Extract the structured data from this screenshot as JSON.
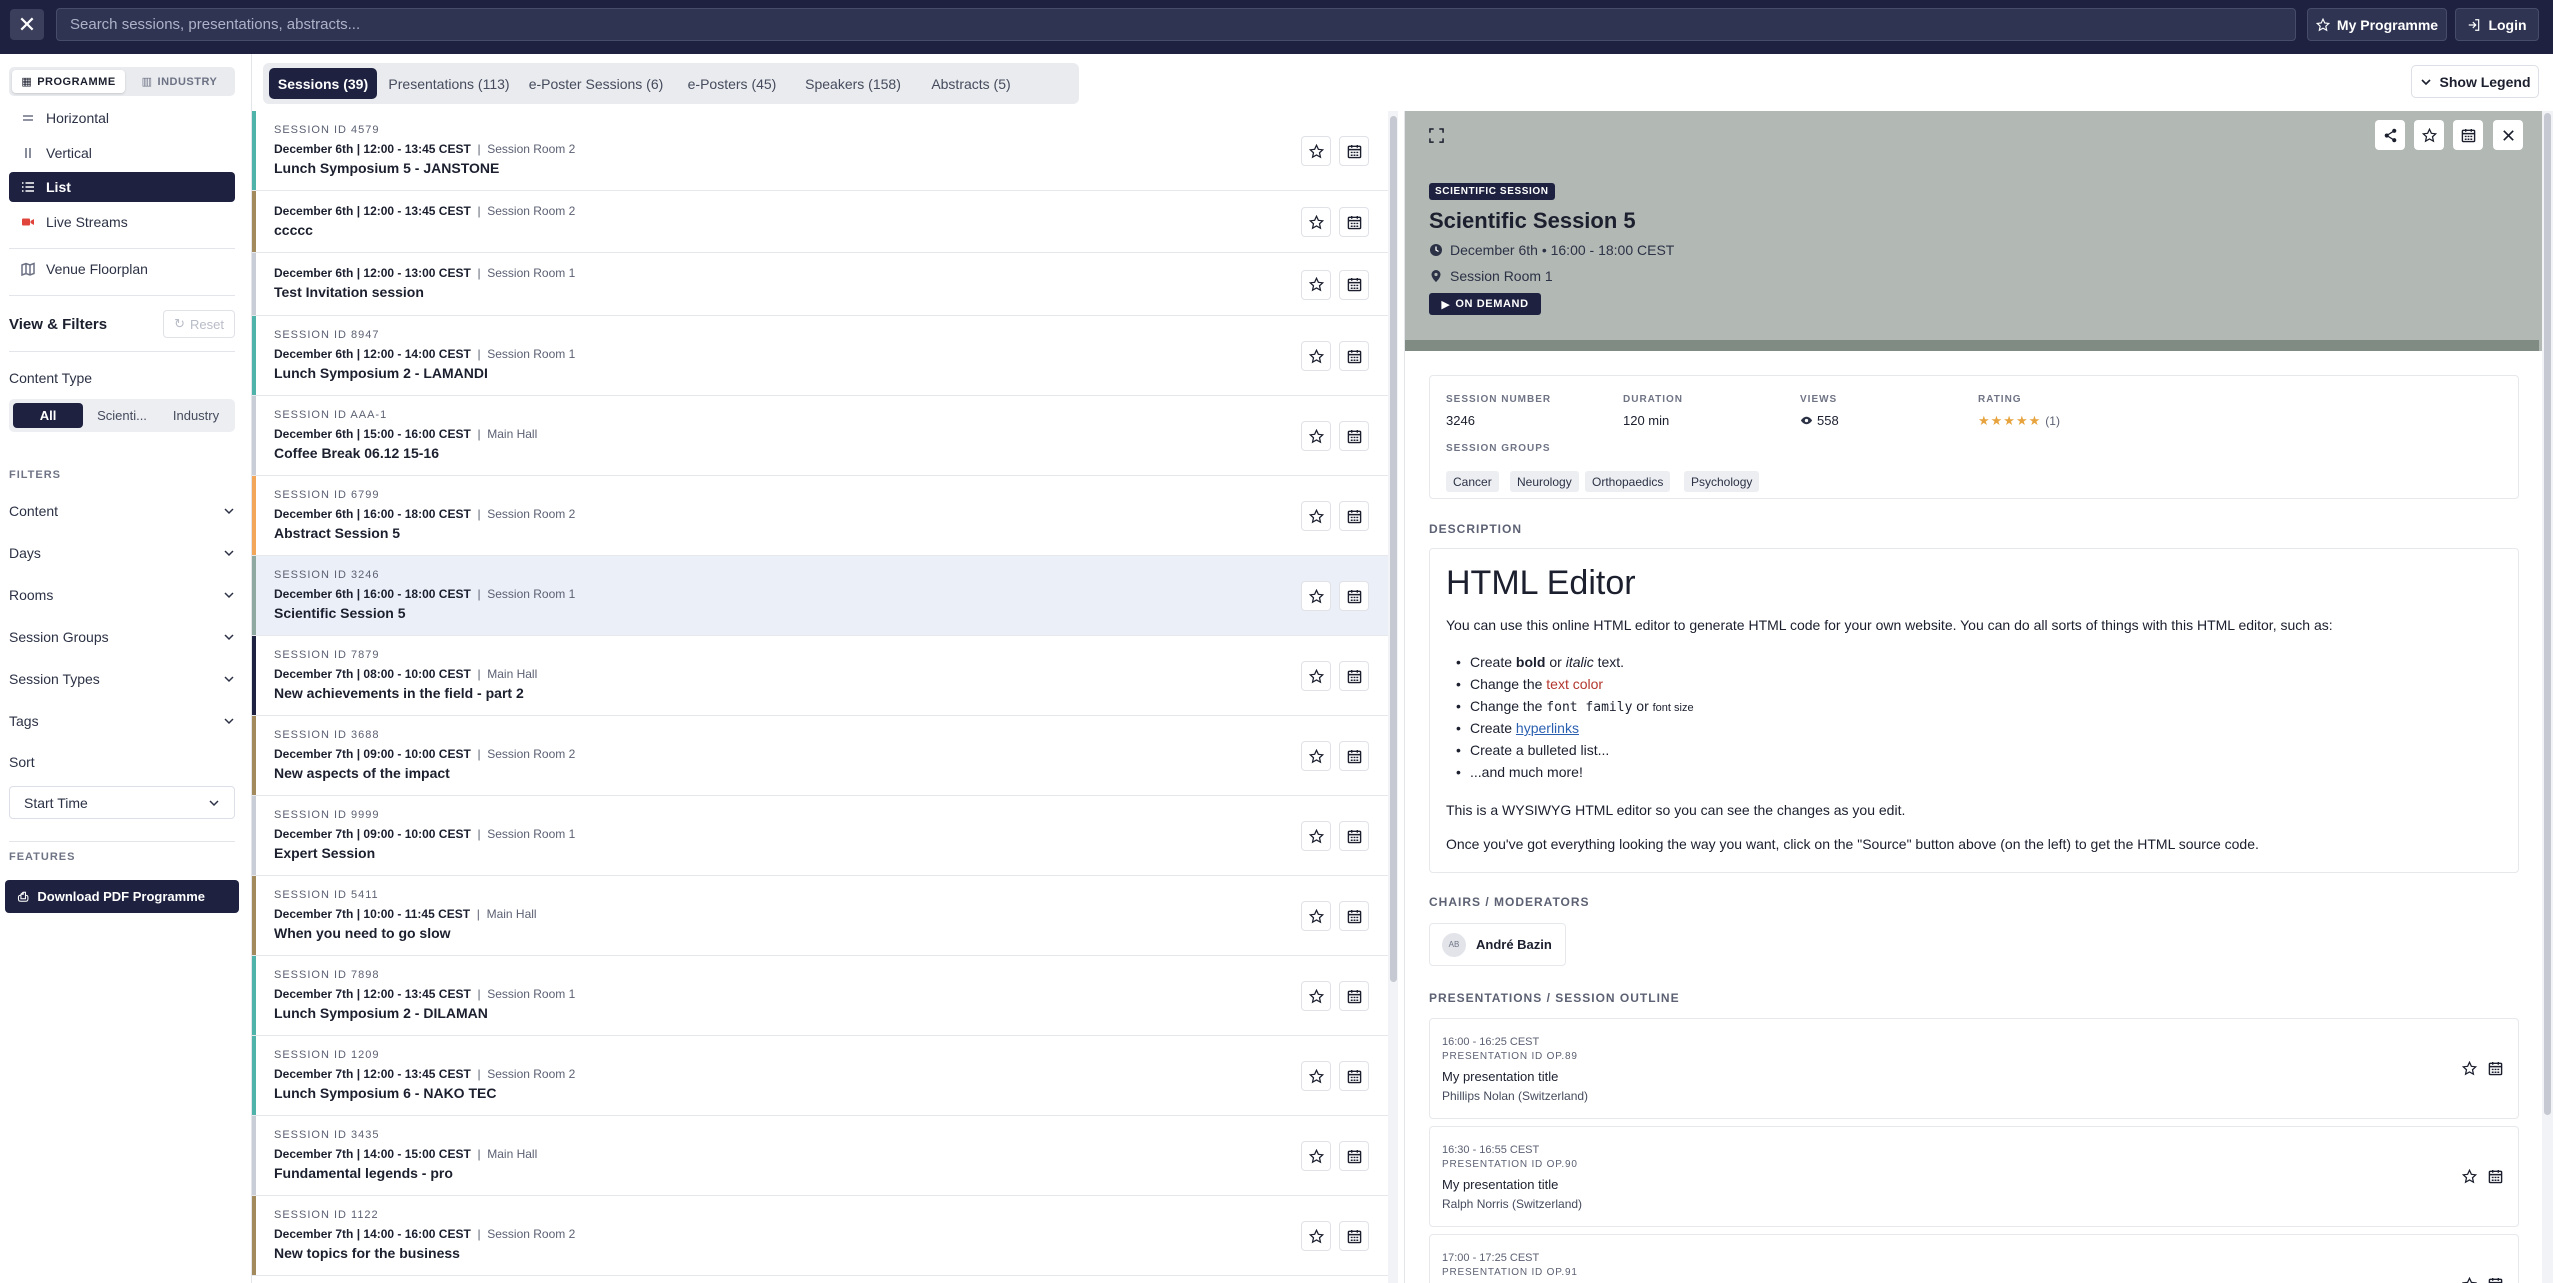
{
  "topbar": {
    "search_placeholder": "Search sessions, presentations, abstracts...",
    "my_programme": "My Programme",
    "login": "Login"
  },
  "sidebar": {
    "modes": [
      "PROGRAMME",
      "INDUSTRY"
    ],
    "views": [
      {
        "label": "Horizontal",
        "icon": "horizontal-lines-icon"
      },
      {
        "label": "Vertical",
        "icon": "vertical-lines-icon"
      },
      {
        "label": "List",
        "icon": "list-icon",
        "active": true
      },
      {
        "label": "Live Streams",
        "icon": "video-icon"
      },
      {
        "label": "Venue Floorplan",
        "icon": "map-icon"
      }
    ],
    "view_filters_title": "View & Filters",
    "reset": "Reset",
    "content_type_label": "Content Type",
    "content_types": [
      "All",
      "Scienti...",
      "Industry"
    ],
    "filters_heading": "FILTERS",
    "filters": [
      "Content",
      "Days",
      "Rooms",
      "Session Groups",
      "Session Types",
      "Tags"
    ],
    "sort_label": "Sort",
    "sort_value": "Start Time",
    "features_heading": "FEATURES",
    "download_pdf": "Download PDF Programme"
  },
  "tabs": [
    {
      "label": "Sessions (39)",
      "active": true
    },
    {
      "label": "Presentations (113)"
    },
    {
      "label": "e-Poster Sessions (6)"
    },
    {
      "label": "e-Posters (45)"
    },
    {
      "label": "Speakers (158)"
    },
    {
      "label": "Abstracts (5)"
    }
  ],
  "show_legend": "Show Legend",
  "sessions": [
    {
      "id": "SESSION ID 4579",
      "date": "December 6th | 12:00 - 13:45 CEST",
      "room": "Session Room 2",
      "title": "Lunch Symposium 5 - JANSTONE",
      "color": "#4fb3a9"
    },
    {
      "id": "",
      "date": "December 6th | 12:00 - 13:45 CEST",
      "room": "Session Room 2",
      "title": "ccccc",
      "color": "#a38a5c"
    },
    {
      "id": "",
      "date": "December 6th | 12:00 - 13:00 CEST",
      "room": "Session Room 1",
      "title": "Test Invitation session",
      "color": "#c9cdd6"
    },
    {
      "id": "SESSION ID 8947",
      "date": "December 6th | 12:00 - 14:00 CEST",
      "room": "Session Room 1",
      "title": "Lunch Symposium 2 - LAMANDI",
      "color": "#4fb3a9"
    },
    {
      "id": "SESSION ID AAA-1",
      "date": "December 6th | 15:00 - 16:00 CEST",
      "room": "Main Hall",
      "title": "Coffee Break 06.12 15-16",
      "color": "#c9cdd6"
    },
    {
      "id": "SESSION ID 6799",
      "date": "December 6th | 16:00 - 18:00 CEST",
      "room": "Session Room 2",
      "title": "Abstract Session 5",
      "color": "#f2a65a"
    },
    {
      "id": "SESSION ID 3246",
      "date": "December 6th | 16:00 - 18:00 CEST",
      "room": "Session Room 1",
      "title": "Scientific Session 5",
      "color": "#8fa9a0",
      "selected": true
    },
    {
      "id": "SESSION ID 7879",
      "date": "December 7th | 08:00 - 10:00 CEST",
      "room": "Main Hall",
      "title": "New achievements in the field - part 2",
      "color": "#1e2240"
    },
    {
      "id": "SESSION ID 3688",
      "date": "December 7th | 09:00 - 10:00 CEST",
      "room": "Session Room 2",
      "title": "New aspects of the impact",
      "color": "#a38a5c"
    },
    {
      "id": "SESSION ID 9999",
      "date": "December 7th | 09:00 - 10:00 CEST",
      "room": "Session Room 1",
      "title": "Expert Session",
      "color": "#c9cdd6"
    },
    {
      "id": "SESSION ID 5411",
      "date": "December 7th | 10:00 - 11:45 CEST",
      "room": "Main Hall",
      "title": "When you need to go slow",
      "color": "#a38a5c"
    },
    {
      "id": "SESSION ID 7898",
      "date": "December 7th | 12:00 - 13:45 CEST",
      "room": "Session Room 1",
      "title": "Lunch Symposium 2 - DILAMAN",
      "color": "#4fb3a9"
    },
    {
      "id": "SESSION ID 1209",
      "date": "December 7th | 12:00 - 13:45 CEST",
      "room": "Session Room 2",
      "title": "Lunch Symposium 6 - NAKO TEC",
      "color": "#4fb3a9"
    },
    {
      "id": "SESSION ID 3435",
      "date": "December 7th | 14:00 - 15:00 CEST",
      "room": "Main Hall",
      "title": "Fundamental legends - pro",
      "color": "#c9cdd6"
    },
    {
      "id": "SESSION ID 1122",
      "date": "December 7th | 14:00 - 16:00 CEST",
      "room": "Session Room 2",
      "title": "New topics for the business",
      "color": "#a38a5c"
    }
  ],
  "detail": {
    "type_tag": "SCIENTIFIC SESSION",
    "title": "Scientific Session 5",
    "datetime": "December 6th • 16:00 - 18:00 CEST",
    "room": "Session Room 1",
    "on_demand": "ON DEMAND",
    "stats": {
      "session_number_label": "SESSION NUMBER",
      "session_number": "3246",
      "duration_label": "DURATION",
      "duration": "120 min",
      "views_label": "VIEWS",
      "views": "558",
      "rating_label": "RATING",
      "rating": 5,
      "rating_count": "(1)"
    },
    "session_groups_label": "SESSION GROUPS",
    "session_groups": [
      "Cancer",
      "Neurology",
      "Orthopaedics",
      "Psychology"
    ],
    "description_label": "DESCRIPTION",
    "description": {
      "heading": "HTML Editor",
      "intro": "You can use this online HTML editor to generate HTML code for your own website. You can do all sorts of things with this HTML editor, such as:",
      "bullets": {
        "b1_pre": "Create ",
        "b1_bold": "bold",
        "b1_mid": " or ",
        "b1_italic": "italic",
        "b1_post": " text.",
        "b2_pre": "Change the ",
        "b2_color": "text color",
        "b3_pre": "Change the ",
        "b3_mono": "font family",
        "b3_mid": " or ",
        "b3_small": "font size",
        "b4_pre": "Create ",
        "b4_link": "hyperlinks",
        "b5": "Create a bulleted list...",
        "b6": "...and much more!"
      },
      "p2": "This is a WYSIWYG HTML editor so you can see the changes as you edit.",
      "p3": "Once you've got everything looking the way you want, click on the \"Source\" button above (on the left) to get the HTML source code."
    },
    "chairs_label": "CHAIRS / MODERATORS",
    "chair": {
      "initials": "AB",
      "name": "André Bazin"
    },
    "outline_label": "PRESENTATIONS / SESSION OUTLINE",
    "presentations": [
      {
        "time": "16:00 - 16:25 CEST",
        "id": "PRESENTATION ID OP.89",
        "title": "My presentation title",
        "author": "Phillips Nolan (Switzerland)"
      },
      {
        "time": "16:30 - 16:55 CEST",
        "id": "PRESENTATION ID OP.90",
        "title": "My presentation title",
        "author": "Ralph Norris (Switzerland)"
      },
      {
        "time": "17:00 - 17:25 CEST",
        "id": "PRESENTATION ID OP.91",
        "title": "",
        "author": ""
      }
    ]
  },
  "colors": {
    "navy": "#1e2240",
    "accent_star": "#e7a33e"
  }
}
